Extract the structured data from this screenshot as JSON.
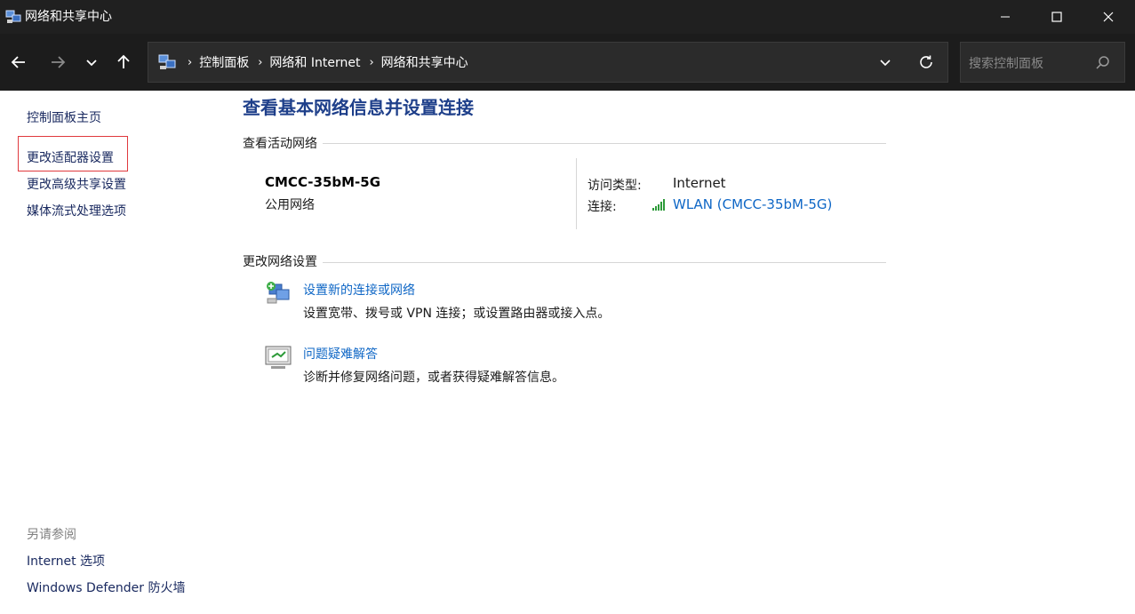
{
  "window": {
    "title": "网络和共享中心"
  },
  "address": {
    "crumbs": [
      "控制面板",
      "网络和 Internet",
      "网络和共享中心"
    ]
  },
  "search": {
    "placeholder": "搜索控制面板"
  },
  "sidebar": {
    "items": [
      {
        "label": "控制面板主页"
      },
      {
        "label": "更改适配器设置"
      },
      {
        "label": "更改高级共享设置"
      },
      {
        "label": "媒体流式处理选项"
      }
    ],
    "see_also_title": "另请参阅",
    "see_also": [
      {
        "label": "Internet 选项"
      },
      {
        "label": "Windows Defender 防火墙"
      }
    ]
  },
  "main": {
    "title": "查看基本网络信息并设置连接",
    "active_section": "查看活动网络",
    "network": {
      "name": "CMCC-35bM-5G",
      "type": "公用网络",
      "access_label": "访问类型:",
      "access_value": "Internet",
      "connection_label": "连接:",
      "connection_value": "WLAN (CMCC-35bM-5G)"
    },
    "change_section": "更改网络设置",
    "tasks": [
      {
        "title": "设置新的连接或网络",
        "desc": "设置宽带、拨号或 VPN 连接；或设置路由器或接入点。",
        "icon": "network-setup-icon"
      },
      {
        "title": "问题疑难解答",
        "desc": "诊断并修复网络问题，或者获得疑难解答信息。",
        "icon": "troubleshoot-icon"
      }
    ]
  },
  "colors": {
    "titlebar": "#202020",
    "navbar": "#1c1c1c",
    "link": "#0f67c6",
    "title": "#1e3f8a",
    "highlight_border": "#e0393e"
  }
}
